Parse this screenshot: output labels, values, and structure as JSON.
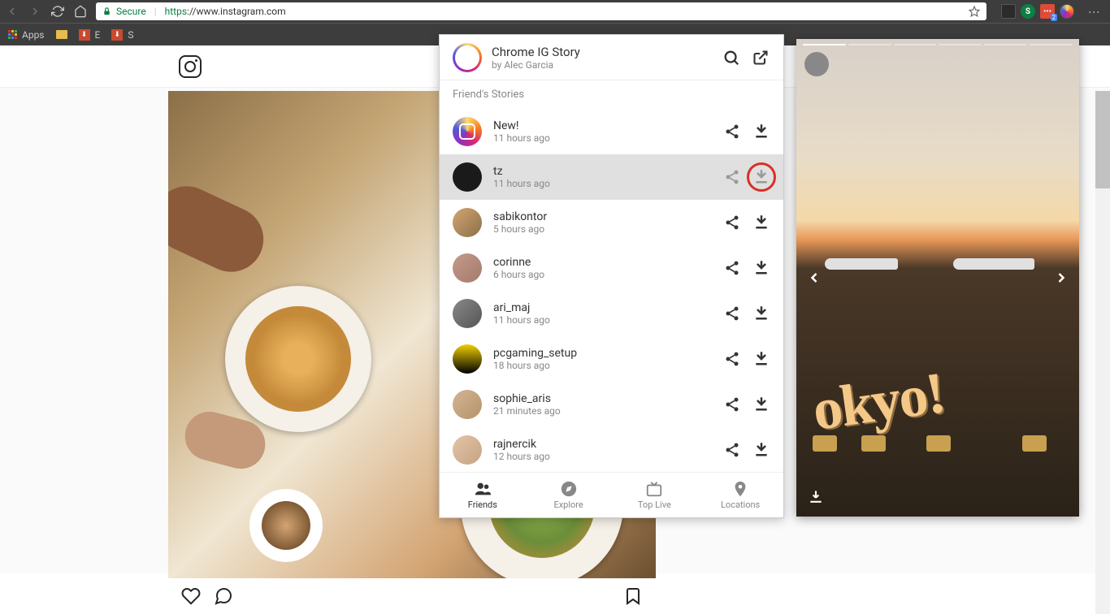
{
  "browser": {
    "secure_label": "Secure",
    "url_protocol": "https",
    "url_host": "://www.instagram.com",
    "bookmarks": {
      "apps": "Apps",
      "items": [
        "E",
        "S"
      ]
    },
    "ext_badge": "2"
  },
  "popup": {
    "title": "Chrome IG Story",
    "subtitle": "by Alec Garcia",
    "section_header": "Friend's Stories",
    "stories": [
      {
        "name": "New!",
        "time": "11 hours ago",
        "avatar": "ig",
        "selected": false
      },
      {
        "name": "tz",
        "time": "11 hours ago",
        "avatar": "dark",
        "selected": true
      },
      {
        "name": "sabikontor",
        "time": "5 hours ago",
        "avatar": "photo1",
        "selected": false
      },
      {
        "name": "corinne",
        "time": "6 hours ago",
        "avatar": "photo2",
        "selected": false
      },
      {
        "name": "ari_maj",
        "time": "11 hours ago",
        "avatar": "photo3",
        "selected": false
      },
      {
        "name": "pcgaming_setup",
        "time": "18 hours ago",
        "avatar": "yellow",
        "selected": false
      },
      {
        "name": "sophie_aris",
        "time": "21 minutes ago",
        "avatar": "photo4",
        "selected": false
      },
      {
        "name": "rajnercik",
        "time": "12 hours ago",
        "avatar": "photo5",
        "selected": false
      }
    ],
    "nav": [
      {
        "label": "Friends",
        "active": true
      },
      {
        "label": "Explore",
        "active": false
      },
      {
        "label": "Top Live",
        "active": false
      },
      {
        "label": "Locations",
        "active": false
      }
    ]
  },
  "story_viewer": {
    "handwriting": "okyo!"
  }
}
